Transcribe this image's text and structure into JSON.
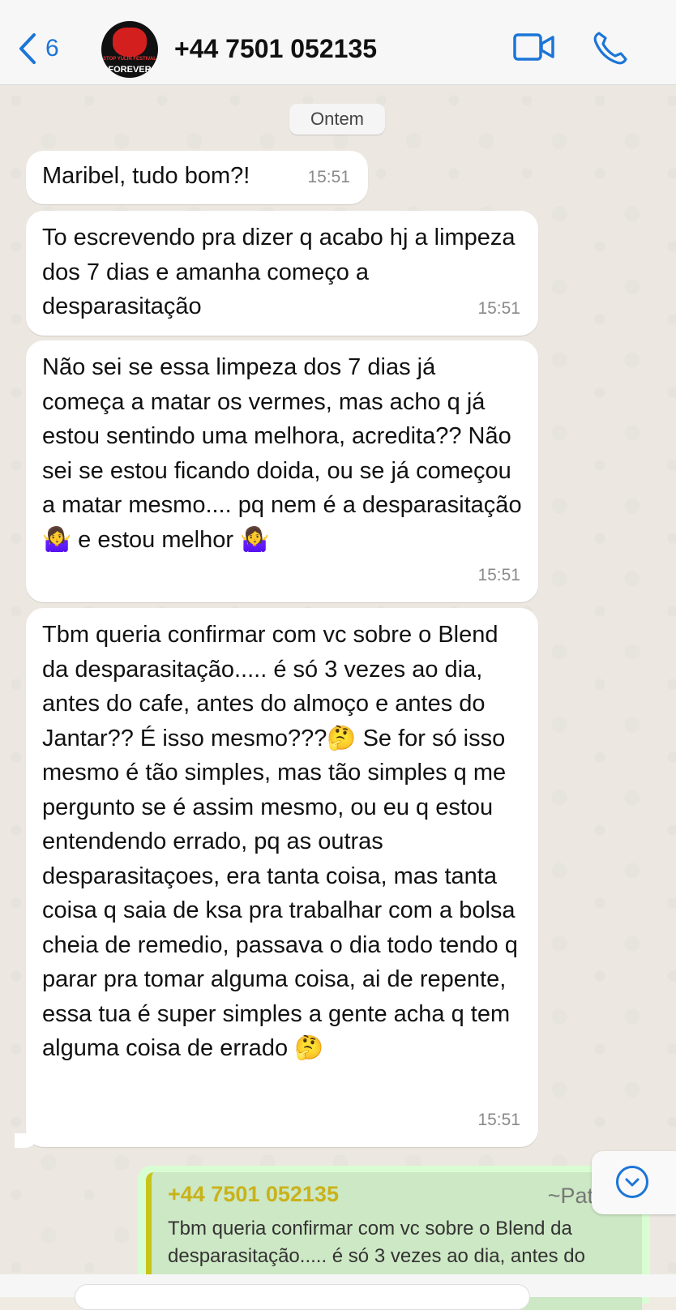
{
  "header": {
    "back_count": "6",
    "contact_name": "+44 7501 052135",
    "avatar_text_top": "STOP YULIN FESTIVAL",
    "avatar_text_bottom": "FOREVER"
  },
  "date_separator": "Ontem",
  "messages": [
    {
      "text": "Maribel, tudo bom?!",
      "time": "15:51"
    },
    {
      "text": "To escrevendo pra dizer q acabo hj a limpeza dos 7 dias e amanha começo a desparasitação",
      "time": "15:51"
    },
    {
      "text_a": "Não sei se essa limpeza dos 7 dias já começa a matar os vermes, mas acho q já estou sentindo uma melhora, acredita?? Não sei se estou ficando doida, ou se já começou a matar mesmo.... pq nem é a desparasitação",
      "emoji_1": "🤷‍♀️",
      "text_b": " e estou melhor ",
      "emoji_2": "🤷‍♀️",
      "time": "15:51"
    },
    {
      "text_a": "Tbm queria confirmar com vc sobre o Blend da desparasitação..... é só 3 vezes ao dia, antes do cafe, antes do almoço e antes do Jantar?? É isso mesmo???",
      "emoji_1": "🤔",
      "text_b": " Se for só isso mesmo é tão simples, mas tão simples q me pergunto se é assim mesmo, ou eu q estou entendendo errado, pq as outras desparasitaçoes, era tanta coisa, mas tanta coisa q saia de ksa pra trabalhar com a bolsa cheia de remedio, passava o dia todo tendo q parar pra tomar alguma coisa, ai de repente, essa tua é super simples a gente acha q tem alguma coisa de errado ",
      "emoji_2": "🤔",
      "time": "15:51"
    }
  ],
  "outgoing_reply": {
    "quoted_name": "+44 7501 052135",
    "quoted_alias": "~Pat",
    "quoted_text": "Tbm queria confirmar com vc sobre o Blend da desparasitação..... é só 3 vezes ao dia, antes do"
  },
  "icons": {
    "back": "chevron-left-icon",
    "video": "video-camera-icon",
    "call": "phone-icon",
    "scroll": "chevron-down-icon"
  },
  "colors": {
    "accent": "#1c75d8",
    "incoming_bubble": "#ffffff",
    "outgoing_bubble": "#d9fdd3",
    "quote_bar": "#c9c41a"
  }
}
